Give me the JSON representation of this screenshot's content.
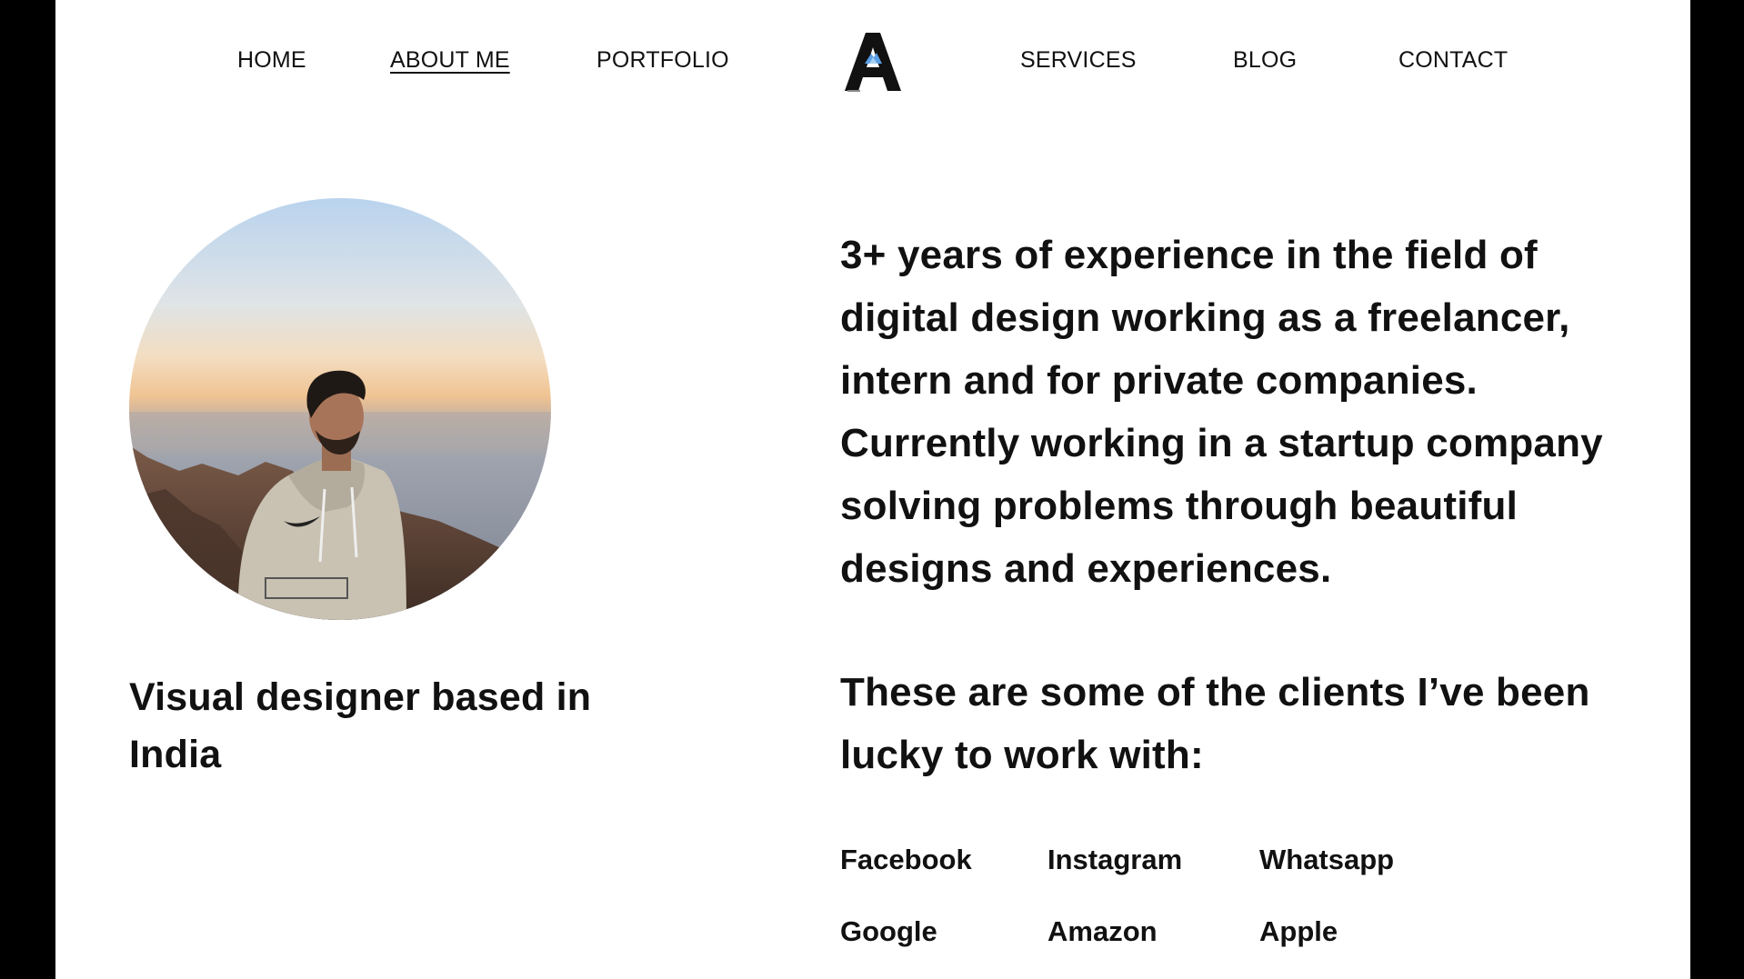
{
  "nav": {
    "home": "HOME",
    "about": "ABOUT ME",
    "portfolio": "PORTFOLIO",
    "services": "SERVICES",
    "blog": "BLOG",
    "contact": "CONTACT",
    "active": "ABOUT ME"
  },
  "logo": {
    "letter": "A",
    "icon": "mountain-letter-a-icon",
    "accent_color": "#5aa0e6"
  },
  "profile": {
    "photo": "profile-photo-mountain-sunset",
    "tagline": "Visual designer based in India"
  },
  "bio": {
    "text": "3+ years of experience in the field of digital design working as a freelancer, intern and for private companies. Currently working in a startup company solving problems through beautiful designs and experiences."
  },
  "clients": {
    "intro": "These are some of the clients I’ve been lucky to work with:",
    "list": [
      "Facebook",
      "Instagram",
      "Whatsapp",
      "Google",
      "Amazon",
      "Apple"
    ]
  },
  "colors": {
    "text": "#111111",
    "background": "#ffffff",
    "frame": "#000000"
  }
}
